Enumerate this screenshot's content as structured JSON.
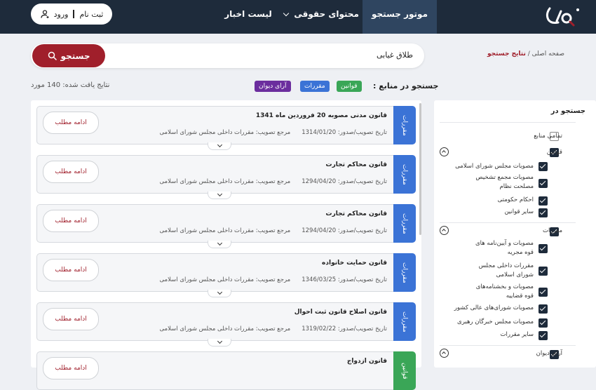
{
  "header": {
    "logo_alt": "logo",
    "nav": {
      "search_engine": "موتور جستجو",
      "legal_content": "محتوای حقوقی",
      "news_list": "لیست اخبار"
    },
    "login": {
      "signup": "ثبت نام",
      "login": "ورود"
    }
  },
  "breadcrumb": {
    "home": "صفحه اصلی",
    "separator": "/",
    "current": "نتایج جستجو"
  },
  "search": {
    "value": "طلاق غیابی",
    "button_label": "جستجو"
  },
  "filters": {
    "source_label": "جستجو در منابع :",
    "chips": [
      "قوانین",
      "مقررات",
      "آرای دیوان"
    ]
  },
  "results_count": {
    "label": "نتایج یافت شده:",
    "count": "140",
    "unit": "مورد"
  },
  "results": [
    {
      "tag": "مقررات",
      "title": "قانون مدنی مصوبه 20 فروردین ماه 1341",
      "date_label": "تاریخ تصویب/صدور:",
      "date": "1314/01/20",
      "ref_label": "مرجع تصویب:",
      "ref": "مقررات داخلی مجلس شورای اسلامی",
      "more": "ادامه مطلب"
    },
    {
      "tag": "مقررات",
      "title": "قانون محاکم تجارت",
      "date_label": "تاریخ تصویب/صدور:",
      "date": "1294/04/20",
      "ref_label": "مرجع تصویب:",
      "ref": "مقررات داخلی مجلس شورای اسلامی",
      "more": "ادامه مطلب"
    },
    {
      "tag": "مقررات",
      "title": "قانون محاکم تجارت",
      "date_label": "تاریخ تصویب/صدور:",
      "date": "1294/04/20",
      "ref_label": "مرجع تصویب:",
      "ref": "مقررات داخلی مجلس شورای اسلامی",
      "more": "ادامه مطلب"
    },
    {
      "tag": "مقررات",
      "title": "قانون حمایت خانواده",
      "date_label": "تاریخ تصویب/صدور:",
      "date": "1346/03/25",
      "ref_label": "مرجع تصویب:",
      "ref": "مقررات داخلی مجلس شورای اسلامی",
      "more": "ادامه مطلب"
    },
    {
      "tag": "مقررات",
      "title": "قانون اصلاح قانون ثبت احوال",
      "date_label": "تاریخ تصویب/صدور:",
      "date": "1319/02/22",
      "ref_label": "مرجع تصویب:",
      "ref": "مقررات داخلی مجلس شورای اسلامی",
      "more": "ادامه مطلب"
    },
    {
      "tag": "قوانین",
      "title": "قانون ازدواج",
      "more": "ادامه مطلب"
    }
  ],
  "sidebar": {
    "title": "جستجو در",
    "all_sources": "تمامی منابع",
    "laws": {
      "label": "قوانین",
      "items": [
        "مصوبات مجلس شورای اسلامی",
        "مصوبات مجمع تشخیص مصلحت نظام",
        "احکام حکومتی",
        "سایر قوانین"
      ]
    },
    "regulations": {
      "label": "مقررات",
      "items": [
        "مصوبات و آیین‌نامه های قوه مجریه",
        "مقررات داخلی مجلس شورای اسلامی",
        "مصوبات و بخشنامه‌های قوه قضاییه",
        "مصوبات شورای‌های عالی کشور",
        "مصوبات مجلس خبرگان رهبری",
        "سایر مقررات"
      ]
    },
    "divan": {
      "label": "آرای دیوان"
    }
  },
  "colors": {
    "header": "#1e2b3b",
    "accent": "#a01f2b",
    "laws": "#3aa657",
    "regulations": "#3b73d6",
    "divan": "#6b2d9e"
  }
}
